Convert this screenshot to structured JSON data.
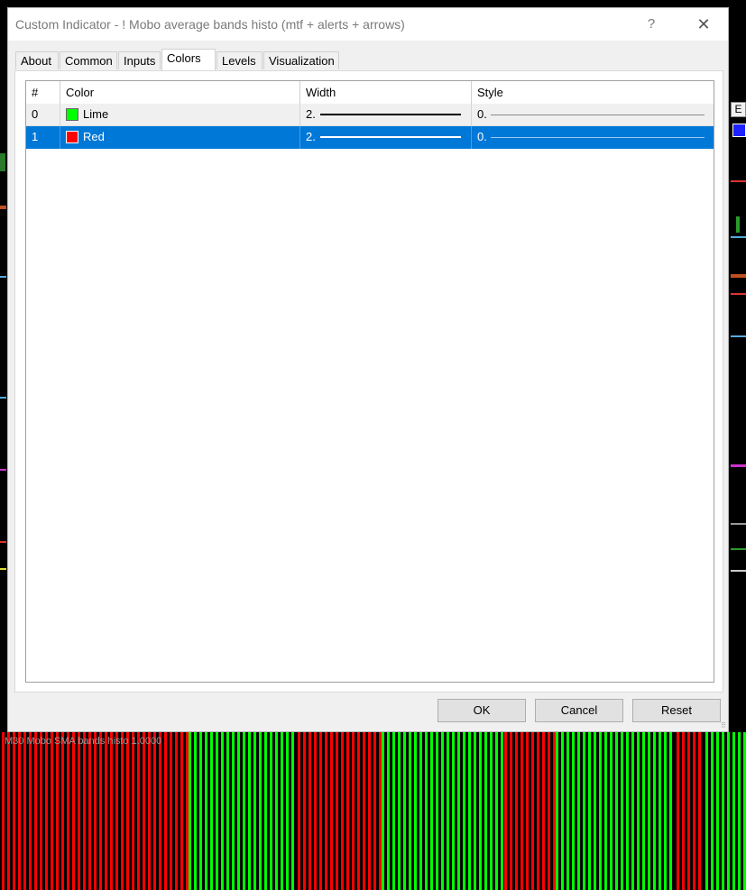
{
  "window": {
    "title": "Custom Indicator - ! Mobo average bands histo (mtf + alerts + arrows)",
    "help_label": "?",
    "close_label": "✕"
  },
  "tabs": [
    {
      "label": "About",
      "active": false
    },
    {
      "label": "Common",
      "active": false
    },
    {
      "label": "Inputs",
      "active": false
    },
    {
      "label": "Colors",
      "active": true
    },
    {
      "label": "Levels",
      "active": false
    },
    {
      "label": "Visualization",
      "active": false
    }
  ],
  "table": {
    "headers": [
      "#",
      "Color",
      "Width",
      "Style"
    ],
    "rows": [
      {
        "index": "0",
        "color_name": "Lime",
        "color_hex": "#00ff00",
        "width": "2.",
        "style": "0.",
        "selected": false
      },
      {
        "index": "1",
        "color_name": "Red",
        "color_hex": "#ff0000",
        "width": "2.",
        "style": "0.",
        "selected": true
      }
    ]
  },
  "buttons": {
    "ok": "OK",
    "cancel": "Cancel",
    "reset": "Reset"
  },
  "background": {
    "histo_label": "M30 Mobo SMA bands histo 1.0000",
    "colors": {
      "up": "#00ff00",
      "down": "#ff0000",
      "selection": "#0078d7"
    },
    "right_edge_button": "E"
  }
}
